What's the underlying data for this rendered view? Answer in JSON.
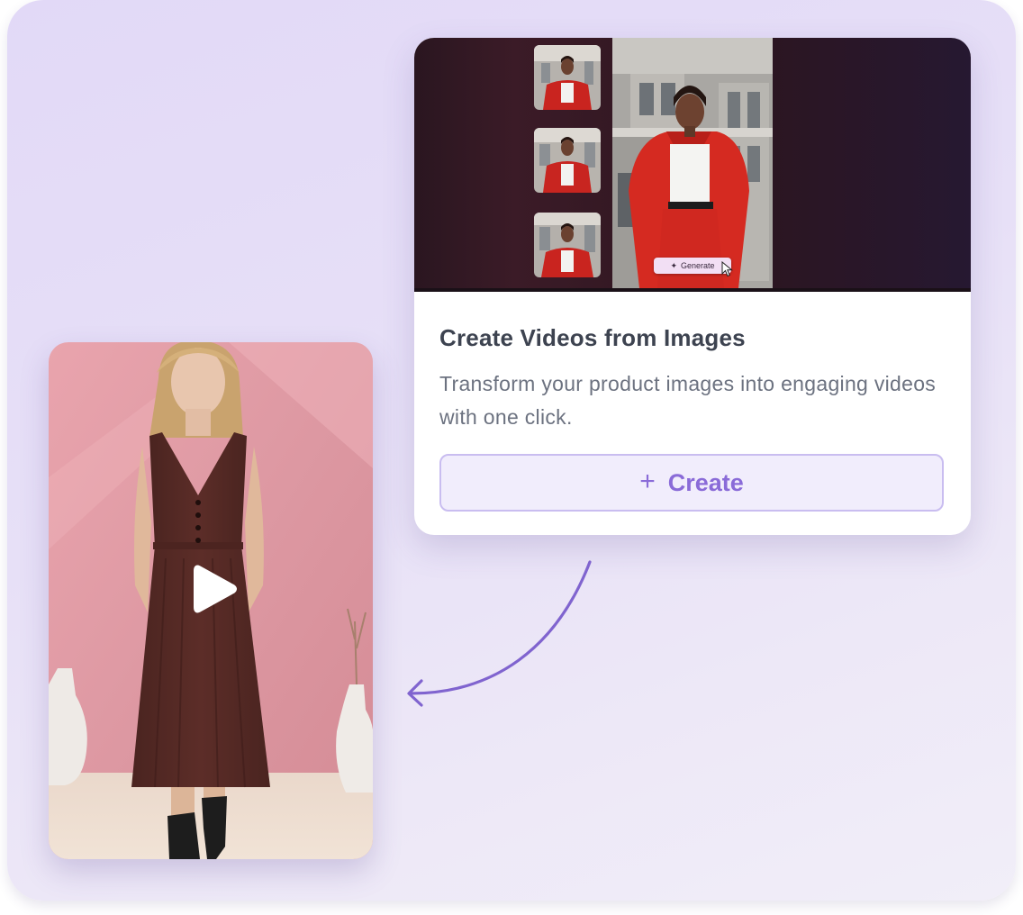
{
  "card": {
    "title": "Create Videos from Images",
    "description": "Transform your product images into engaging videos with one click.",
    "create_button": {
      "icon": "plus-icon",
      "label": "Create"
    },
    "preview": {
      "generate_label": "Generate",
      "thumbnails": 3
    }
  },
  "video_preview": {
    "play_icon": "play-icon"
  },
  "colors": {
    "accent": "#8a6bd8",
    "button_border": "#c9bdf0",
    "button_bg": "#f1edfc",
    "title": "#3d4350",
    "body_text": "#6c7280",
    "background": "#e7e0f7"
  }
}
